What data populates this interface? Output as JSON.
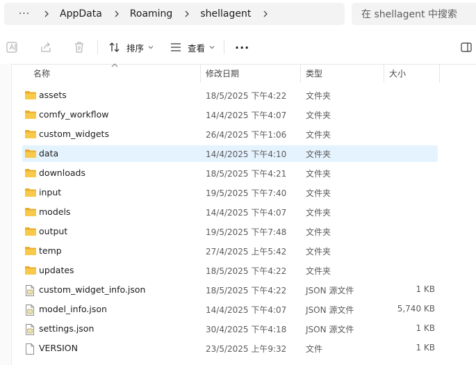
{
  "address": {
    "more_label": "···",
    "crumbs": [
      "AppData",
      "Roaming",
      "shellagent"
    ],
    "search_placeholder": "在 shellagent 中搜索"
  },
  "toolbar": {
    "sort_label": "排序",
    "view_label": "查看",
    "more_label": "···"
  },
  "columns": {
    "name": "名称",
    "modified": "修改日期",
    "type": "类型",
    "size": "大小"
  },
  "files": [
    {
      "name": "assets",
      "date": "18/5/2025 下午4:22",
      "type": "文件夹",
      "size": "",
      "kind": "folder-icon"
    },
    {
      "name": "comfy_workflow",
      "date": "14/4/2025 下午4:07",
      "type": "文件夹",
      "size": "",
      "kind": "folder-icon"
    },
    {
      "name": "custom_widgets",
      "date": "26/4/2025 下午1:06",
      "type": "文件夹",
      "size": "",
      "kind": "folder-icon"
    },
    {
      "name": "data",
      "date": "14/4/2025 下午4:10",
      "type": "文件夹",
      "size": "",
      "kind": "folder-icon",
      "selected": true
    },
    {
      "name": "downloads",
      "date": "18/5/2025 下午4:21",
      "type": "文件夹",
      "size": "",
      "kind": "folder-icon"
    },
    {
      "name": "input",
      "date": "19/5/2025 下午7:40",
      "type": "文件夹",
      "size": "",
      "kind": "folder-icon"
    },
    {
      "name": "models",
      "date": "14/4/2025 下午4:07",
      "type": "文件夹",
      "size": "",
      "kind": "folder-icon"
    },
    {
      "name": "output",
      "date": "19/5/2025 下午7:48",
      "type": "文件夹",
      "size": "",
      "kind": "folder-icon"
    },
    {
      "name": "temp",
      "date": "27/4/2025 上午5:42",
      "type": "文件夹",
      "size": "",
      "kind": "folder-icon"
    },
    {
      "name": "updates",
      "date": "18/5/2025 下午4:22",
      "type": "文件夹",
      "size": "",
      "kind": "folder-icon"
    },
    {
      "name": "custom_widget_info.json",
      "date": "18/5/2025 下午4:22",
      "type": "JSON 源文件",
      "size": "1 KB",
      "kind": "json-file-icon"
    },
    {
      "name": "model_info.json",
      "date": "14/4/2025 下午4:07",
      "type": "JSON 源文件",
      "size": "5,740 KB",
      "kind": "json-file-icon"
    },
    {
      "name": "settings.json",
      "date": "30/4/2025 下午4:18",
      "type": "JSON 源文件",
      "size": "1 KB",
      "kind": "json-file-icon"
    },
    {
      "name": "VERSION",
      "date": "23/5/2025 上午9:32",
      "type": "文件",
      "size": "1 KB",
      "kind": "file-icon"
    }
  ],
  "colors": {
    "selected_row": "#e5f3ff",
    "folder_yellow": "#f8c94a",
    "folder_tab": "#e8ad2b"
  }
}
